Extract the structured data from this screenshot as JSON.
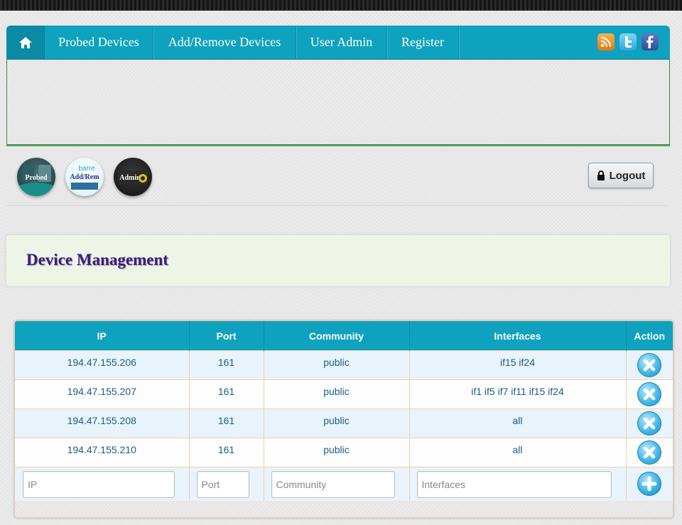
{
  "nav": {
    "home_icon": "home-icon",
    "items": [
      "Probed Devices",
      "Add/Remove Devices",
      "User Admin",
      "Register"
    ],
    "social": [
      "rss-icon",
      "twitter-icon",
      "facebook-icon"
    ]
  },
  "shortcuts": [
    {
      "label": "Probed",
      "icon": "probed-shortcut"
    },
    {
      "label": "Add/Rem",
      "icon": "addrem-shortcut"
    },
    {
      "label": "Admin",
      "icon": "admin-shortcut"
    }
  ],
  "shortcut_extra": {
    "brand": "barre"
  },
  "logout": {
    "label": "Logout",
    "icon": "lock-icon"
  },
  "page_title": "Device Management",
  "table": {
    "headers": [
      "IP",
      "Port",
      "Community",
      "Interfaces",
      "Action"
    ],
    "rows": [
      {
        "ip": "194.47.155.206",
        "port": "161",
        "community": "public",
        "interfaces": "if15 if24"
      },
      {
        "ip": "194.47.155.207",
        "port": "161",
        "community": "public",
        "interfaces": "if1 if5 if7 if11 if15 if24"
      },
      {
        "ip": "194.47.155.208",
        "port": "161",
        "community": "public",
        "interfaces": "all"
      },
      {
        "ip": "194.47.155.210",
        "port": "161",
        "community": "public",
        "interfaces": "all"
      }
    ],
    "add_row": {
      "ip_placeholder": "IP",
      "port_placeholder": "Port",
      "community_placeholder": "Community",
      "interfaces_placeholder": "Interfaces"
    }
  },
  "colors": {
    "nav": "#0fa2bf",
    "title": "#3b1a82",
    "title_bg": "#eef5e7",
    "cell_text": "#1a5f85"
  }
}
